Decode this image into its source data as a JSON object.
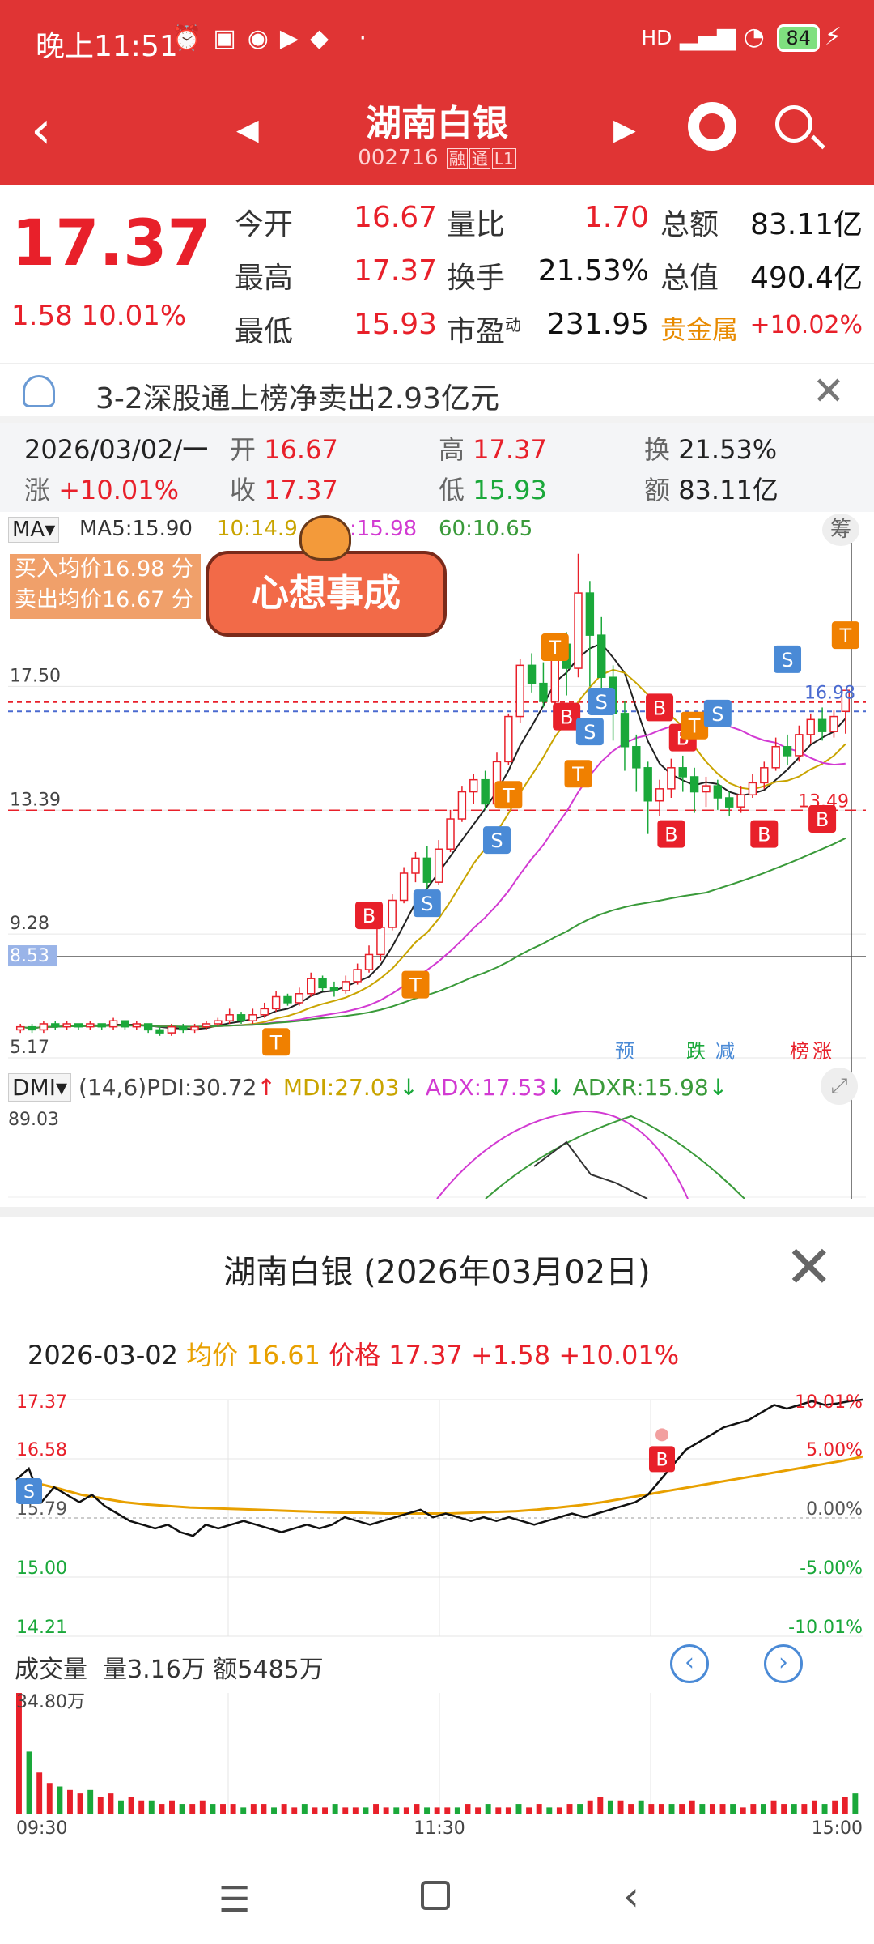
{
  "status_bar": {
    "time": "晚上11:51",
    "network": "HD",
    "battery": "84"
  },
  "header": {
    "title": "湖南白银",
    "code": "002716",
    "tags": [
      "融",
      "通",
      "L1"
    ]
  },
  "quote": {
    "price": "17.37",
    "change": "1.58",
    "change_pct": "10.01%",
    "fields": [
      {
        "label": "今开",
        "value": "16.67"
      },
      {
        "label": "量比",
        "value": "1.70"
      },
      {
        "label": "总额",
        "value": "83.11亿"
      },
      {
        "label": "最高",
        "value": "17.37"
      },
      {
        "label": "换手",
        "value": "21.53%"
      },
      {
        "label": "总值",
        "value": "490.4亿"
      },
      {
        "label": "最低",
        "value": "15.93"
      },
      {
        "label": "市盈",
        "sup": "动",
        "value": "231.95"
      },
      {
        "label": "贵金属",
        "value": "+10.02%"
      }
    ]
  },
  "notice": {
    "text": "3-2深股通上榜净卖出2.93亿元"
  },
  "kline_info": {
    "date": "2026/03/02/一",
    "open_label": "开",
    "open": "16.67",
    "high_label": "高",
    "high": "17.37",
    "turnover_label": "换",
    "turnover": "21.53%",
    "rise_label": "涨",
    "rise": "+10.01%",
    "close_label": "收",
    "close": "17.37",
    "low_label": "低",
    "low": "15.93",
    "amount_label": "额",
    "amount": "83.11亿"
  },
  "ma_bar": {
    "selector": "MA",
    "ma5": "MA5:15.90",
    "ma10": "10:14.9",
    "ma20": ":15.98",
    "ma60": "60:10.65",
    "chip_btn": "筹"
  },
  "trade_box": {
    "buy_avg": "买入均价16.98 分",
    "sell_avg": "卖出均价16.67 分",
    "banner": "心想事成"
  },
  "kchart": {
    "y_labels": [
      "17.50",
      "13.39",
      "9.28",
      "8.53",
      "5.17"
    ],
    "price_tags": [
      "16.98",
      "13.49"
    ],
    "markers_bottom": [
      "预",
      "跌",
      "减",
      "榜",
      "涨"
    ],
    "colors": {
      "up": "#e8202a",
      "down": "#1aa83a",
      "ma5": "#222222",
      "ma10": "#c9a400",
      "ma20": "#d23ad2",
      "ma60": "#3a9a3a"
    },
    "candles": [
      [
        6.1,
        6.2,
        6.0,
        6.3
      ],
      [
        6.2,
        6.1,
        6.0,
        6.3
      ],
      [
        6.1,
        6.3,
        6.0,
        6.4
      ],
      [
        6.3,
        6.2,
        6.1,
        6.4
      ],
      [
        6.2,
        6.3,
        6.1,
        6.4
      ],
      [
        6.3,
        6.2,
        6.1,
        6.3
      ],
      [
        6.2,
        6.3,
        6.1,
        6.4
      ],
      [
        6.3,
        6.2,
        6.1,
        6.3
      ],
      [
        6.2,
        6.4,
        6.1,
        6.5
      ],
      [
        6.4,
        6.2,
        6.1,
        6.4
      ],
      [
        6.2,
        6.3,
        6.1,
        6.4
      ],
      [
        6.3,
        6.1,
        6.0,
        6.3
      ],
      [
        6.1,
        6.0,
        5.9,
        6.2
      ],
      [
        6.0,
        6.2,
        5.9,
        6.3
      ],
      [
        6.2,
        6.1,
        6.0,
        6.3
      ],
      [
        6.1,
        6.2,
        6.0,
        6.3
      ],
      [
        6.2,
        6.3,
        6.1,
        6.4
      ],
      [
        6.3,
        6.4,
        6.2,
        6.5
      ],
      [
        6.4,
        6.6,
        6.3,
        6.8
      ],
      [
        6.6,
        6.4,
        6.3,
        6.7
      ],
      [
        6.4,
        6.6,
        6.3,
        6.8
      ],
      [
        6.6,
        6.8,
        6.5,
        7.0
      ],
      [
        6.8,
        7.2,
        6.7,
        7.4
      ],
      [
        7.2,
        7.0,
        6.9,
        7.3
      ],
      [
        7.0,
        7.3,
        6.9,
        7.5
      ],
      [
        7.3,
        7.8,
        7.2,
        8.0
      ],
      [
        7.8,
        7.5,
        7.4,
        7.9
      ],
      [
        7.5,
        7.4,
        7.2,
        7.7
      ],
      [
        7.4,
        7.7,
        7.3,
        7.9
      ],
      [
        7.7,
        8.1,
        7.6,
        8.3
      ],
      [
        8.1,
        8.6,
        8.0,
        8.9
      ],
      [
        8.6,
        9.5,
        8.4,
        9.7
      ],
      [
        9.5,
        10.4,
        9.4,
        10.6
      ],
      [
        10.4,
        11.3,
        10.3,
        11.5
      ],
      [
        11.3,
        11.8,
        11.0,
        12.0
      ],
      [
        11.8,
        11.0,
        10.8,
        12.2
      ],
      [
        11.0,
        12.1,
        10.9,
        12.4
      ],
      [
        12.1,
        13.1,
        12.0,
        13.4
      ],
      [
        13.1,
        14.0,
        13.0,
        14.2
      ],
      [
        14.0,
        14.4,
        13.6,
        14.6
      ],
      [
        14.4,
        13.6,
        13.4,
        14.7
      ],
      [
        13.6,
        15.0,
        13.5,
        15.3
      ],
      [
        15.0,
        16.5,
        14.9,
        16.6
      ],
      [
        16.5,
        18.2,
        16.3,
        18.4
      ],
      [
        18.2,
        17.6,
        17.3,
        18.6
      ],
      [
        17.6,
        17.0,
        16.8,
        18.3
      ],
      [
        17.0,
        18.9,
        16.9,
        19.2
      ],
      [
        18.9,
        18.1,
        17.2,
        19.3
      ],
      [
        18.1,
        20.6,
        17.8,
        21.9
      ],
      [
        20.6,
        19.2,
        17.5,
        21.0
      ],
      [
        19.2,
        17.8,
        17.0,
        19.8
      ],
      [
        17.8,
        16.6,
        15.7,
        18.2
      ],
      [
        16.6,
        15.5,
        14.7,
        17.0
      ],
      [
        15.5,
        14.8,
        14.0,
        15.9
      ],
      [
        14.8,
        13.7,
        12.6,
        15.0
      ],
      [
        13.7,
        14.1,
        13.2,
        14.4
      ],
      [
        14.1,
        14.8,
        13.8,
        15.1
      ],
      [
        14.8,
        14.5,
        14.0,
        15.2
      ],
      [
        14.5,
        14.0,
        13.3,
        14.8
      ],
      [
        14.0,
        14.2,
        13.5,
        14.5
      ],
      [
        14.2,
        13.8,
        13.4,
        14.4
      ],
      [
        13.8,
        13.5,
        13.2,
        14.0
      ],
      [
        13.5,
        13.9,
        13.3,
        14.2
      ],
      [
        13.9,
        14.3,
        13.8,
        14.6
      ],
      [
        14.3,
        14.8,
        14.1,
        15.0
      ],
      [
        14.8,
        15.5,
        14.7,
        15.8
      ],
      [
        15.5,
        15.2,
        14.9,
        15.9
      ],
      [
        15.2,
        15.9,
        15.0,
        16.2
      ],
      [
        15.9,
        16.4,
        15.6,
        16.6
      ],
      [
        16.4,
        16.0,
        15.7,
        16.8
      ],
      [
        16.0,
        16.5,
        15.8,
        16.7
      ],
      [
        16.67,
        17.37,
        15.93,
        17.37
      ]
    ]
  },
  "dmi": {
    "selector": "DMI",
    "params": "(14,6)",
    "pdi": "PDI:30.72",
    "mdi": "MDI:27.03",
    "adx": "ADX:17.53",
    "adxr": "ADXR:15.98",
    "top": "89.03"
  },
  "sheet": {
    "title": "湖南白银 (2026年03月02日)",
    "date": "2026-03-02",
    "avg_label": "均价",
    "avg": "16.61",
    "price_label": "价格",
    "price": "17.37",
    "chg": "+1.58",
    "pct": "+10.01%",
    "y_left": [
      "17.37",
      "16.58",
      "15.79",
      "15.00",
      "14.21"
    ],
    "y_right": [
      "10.01%",
      "5.00%",
      "0.00%",
      "-5.00%",
      "-10.01%"
    ],
    "vol_label": "成交量",
    "vol": "量3.16万",
    "amt": "额5485万",
    "vol_top": "34.80万",
    "time_labels": [
      "09:30",
      "11:30",
      "15:00"
    ],
    "price_series": [
      16.3,
      16.45,
      16.0,
      16.2,
      16.1,
      16.0,
      16.1,
      15.95,
      15.85,
      15.75,
      15.7,
      15.65,
      15.7,
      15.6,
      15.55,
      15.7,
      15.65,
      15.7,
      15.75,
      15.7,
      15.65,
      15.6,
      15.65,
      15.7,
      15.65,
      15.7,
      15.8,
      15.75,
      15.7,
      15.75,
      15.8,
      15.85,
      15.9,
      15.8,
      15.85,
      15.8,
      15.75,
      15.8,
      15.75,
      15.8,
      15.75,
      15.7,
      15.75,
      15.8,
      15.85,
      15.8,
      15.85,
      15.9,
      15.95,
      16.0,
      16.1,
      16.3,
      16.5,
      16.7,
      16.8,
      16.9,
      17.0,
      17.05,
      17.1,
      17.2,
      17.3,
      17.25,
      17.3,
      17.35,
      17.3,
      17.32,
      17.35,
      17.37
    ],
    "avg_series": [
      16.3,
      16.25,
      16.18,
      16.1,
      16.05,
      16.0,
      15.97,
      15.95,
      15.93,
      15.92,
      15.91,
      15.9,
      15.89,
      15.88,
      15.87,
      15.86,
      15.86,
      15.85,
      15.85,
      15.85,
      15.85,
      15.86,
      15.87,
      15.88,
      15.9,
      15.93,
      15.96,
      16.0,
      16.05,
      16.1,
      16.15,
      16.2,
      16.25,
      16.3,
      16.35,
      16.4,
      16.45,
      16.5,
      16.55,
      16.61
    ],
    "volumes": [
      34.8,
      18,
      12,
      9,
      8,
      7,
      6,
      7,
      5,
      6,
      4,
      5,
      4,
      4,
      3,
      4,
      3,
      3,
      4,
      3,
      3,
      3,
      2,
      3,
      3,
      2,
      3,
      2,
      3,
      2,
      2,
      3,
      2,
      2,
      2,
      3,
      2,
      2,
      2,
      3,
      2,
      2,
      2,
      2,
      3,
      2,
      3,
      2,
      2,
      3,
      2,
      3,
      2,
      2,
      3,
      3,
      4,
      5,
      4,
      4,
      3,
      4,
      3,
      3,
      3,
      3,
      4,
      3,
      3,
      3,
      3,
      2,
      3,
      3,
      4,
      3,
      3,
      3,
      4,
      3,
      4,
      5,
      6
    ],
    "vol_up_colors": "#e8202a"
  },
  "sys_nav": {
    "menu": "menu-icon",
    "home": "home-icon",
    "back": "back-icon"
  }
}
